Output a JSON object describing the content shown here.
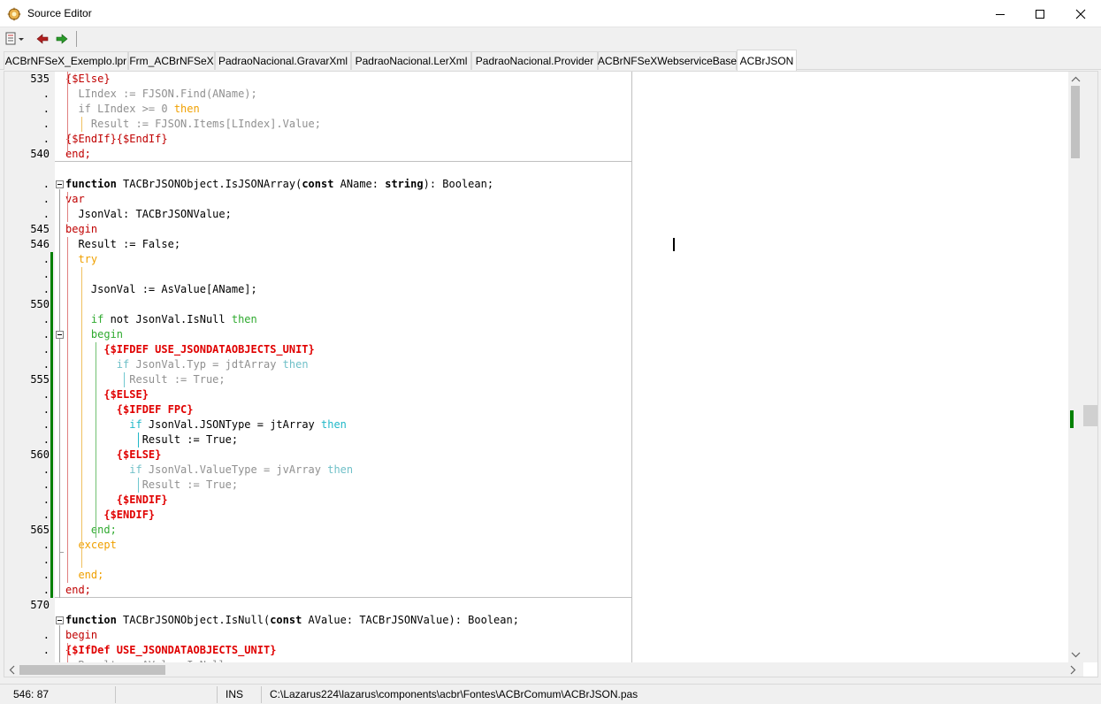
{
  "window": {
    "title": "Source Editor"
  },
  "tabs": [
    {
      "label": "ACBrNFSeX_Exemplo.lpr",
      "active": false
    },
    {
      "label": "Frm_ACBrNFSeX",
      "active": false
    },
    {
      "label": "PadraoNacional.GravarXml",
      "active": false
    },
    {
      "label": "PadraoNacional.LerXml",
      "active": false
    },
    {
      "label": "PadraoNacional.Provider",
      "active": false
    },
    {
      "label": "ACBrNFSeXWebserviceBase",
      "active": false
    },
    {
      "label": "ACBrJSON",
      "active": true
    }
  ],
  "gutter": {
    "lines": [
      "535",
      ".",
      ".",
      ".",
      ".",
      "540",
      "",
      ".",
      ".",
      ".",
      "545",
      "546",
      ".",
      ".",
      ".",
      "550",
      ".",
      ".",
      ".",
      ".",
      "555",
      ".",
      ".",
      ".",
      ".",
      "560",
      ".",
      ".",
      ".",
      ".",
      "565",
      ".",
      ".",
      ".",
      ".",
      "570",
      "",
      ".",
      ".",
      "."
    ]
  },
  "code": {
    "lines": [
      [
        {
          "t": "{$Else}",
          "c": "red"
        }
      ],
      [
        {
          "t": "  LIndex := FJSON.Find(AName);",
          "c": "dim"
        }
      ],
      [
        {
          "t": "  if LIndex >= 0 ",
          "c": "dim"
        },
        {
          "t": "then",
          "c": "orange"
        }
      ],
      [
        {
          "t": "    Result := FJSON.Items[LIndex].Value;",
          "c": "dim"
        }
      ],
      [
        {
          "t": "{$EndIf}{$EndIf}",
          "c": "red"
        }
      ],
      [
        {
          "t": "end;",
          "c": "red"
        }
      ],
      [],
      [
        {
          "t": "function",
          "c": "kw"
        },
        {
          "t": " TACBrJSONObject.IsJSONArray(",
          "c": ""
        },
        {
          "t": "const",
          "c": "kw"
        },
        {
          "t": " AName: ",
          "c": ""
        },
        {
          "t": "string",
          "c": "kw"
        },
        {
          "t": "): Boolean;",
          "c": ""
        }
      ],
      [
        {
          "t": "var",
          "c": "red"
        }
      ],
      [
        {
          "t": "  JsonVal: TACBrJSONValue;",
          "c": ""
        }
      ],
      [
        {
          "t": "begin",
          "c": "red"
        }
      ],
      [
        {
          "t": "  Result := False;",
          "c": ""
        }
      ],
      [
        {
          "t": "  try",
          "c": "orange"
        }
      ],
      [],
      [
        {
          "t": "    JsonVal := AsValue[AName];",
          "c": ""
        }
      ],
      [],
      [
        {
          "t": "    ",
          "c": ""
        },
        {
          "t": "if",
          "c": "green"
        },
        {
          "t": " not JsonVal.IsNull ",
          "c": ""
        },
        {
          "t": "then",
          "c": "green"
        }
      ],
      [
        {
          "t": "    begin",
          "c": "green"
        }
      ],
      [
        {
          "t": "      {$IFDEF USE_JSONDATAOBJECTS_UNIT}",
          "c": "dir"
        }
      ],
      [
        {
          "t": "        ",
          "c": ""
        },
        {
          "t": "if",
          "c": "lteal"
        },
        {
          "t": " JsonVal.Typ = jdtArray ",
          "c": "dim"
        },
        {
          "t": "then",
          "c": "lteal"
        }
      ],
      [
        {
          "t": "          Result := True;",
          "c": "dim"
        }
      ],
      [
        {
          "t": "      {$ELSE}",
          "c": "dir"
        }
      ],
      [
        {
          "t": "        {$IFDEF FPC}",
          "c": "dir"
        }
      ],
      [
        {
          "t": "          ",
          "c": ""
        },
        {
          "t": "if",
          "c": "cyan"
        },
        {
          "t": " JsonVal.JSONType = jtArray ",
          "c": ""
        },
        {
          "t": "then",
          "c": "cyan"
        }
      ],
      [
        {
          "t": "            Result := True;",
          "c": ""
        }
      ],
      [
        {
          "t": "        {$ELSE}",
          "c": "dir"
        }
      ],
      [
        {
          "t": "          ",
          "c": ""
        },
        {
          "t": "if",
          "c": "lteal"
        },
        {
          "t": " JsonVal.ValueType = jvArray ",
          "c": "dim"
        },
        {
          "t": "then",
          "c": "lteal"
        }
      ],
      [
        {
          "t": "            Result := True;",
          "c": "dim"
        }
      ],
      [
        {
          "t": "        {$ENDIF}",
          "c": "dir"
        }
      ],
      [
        {
          "t": "      {$ENDIF}",
          "c": "dir"
        }
      ],
      [
        {
          "t": "    end;",
          "c": "green"
        }
      ],
      [
        {
          "t": "  except",
          "c": "orange"
        }
      ],
      [],
      [
        {
          "t": "  end;",
          "c": "orange"
        }
      ],
      [
        {
          "t": "end;",
          "c": "red"
        }
      ],
      [],
      [
        {
          "t": "function",
          "c": "kw"
        },
        {
          "t": " TACBrJSONObject.IsNull(",
          "c": ""
        },
        {
          "t": "const",
          "c": "kw"
        },
        {
          "t": " AValue: TACBrJSONValue): Boolean;",
          "c": ""
        }
      ],
      [
        {
          "t": "begin",
          "c": "red"
        }
      ],
      [
        {
          "t": "{$IfDef USE_JSONDATAOBJECTS_UNIT}",
          "c": "dir"
        }
      ],
      [
        {
          "t": "  Result := AValue.IsNull;",
          "c": "dim"
        }
      ]
    ]
  },
  "status": {
    "position": "546: 87",
    "mode": "INS",
    "file_path": "C:\\Lazarus224\\lazarus\\components\\acbr\\Fontes\\ACBrComum\\ACBrJSON.pas"
  }
}
